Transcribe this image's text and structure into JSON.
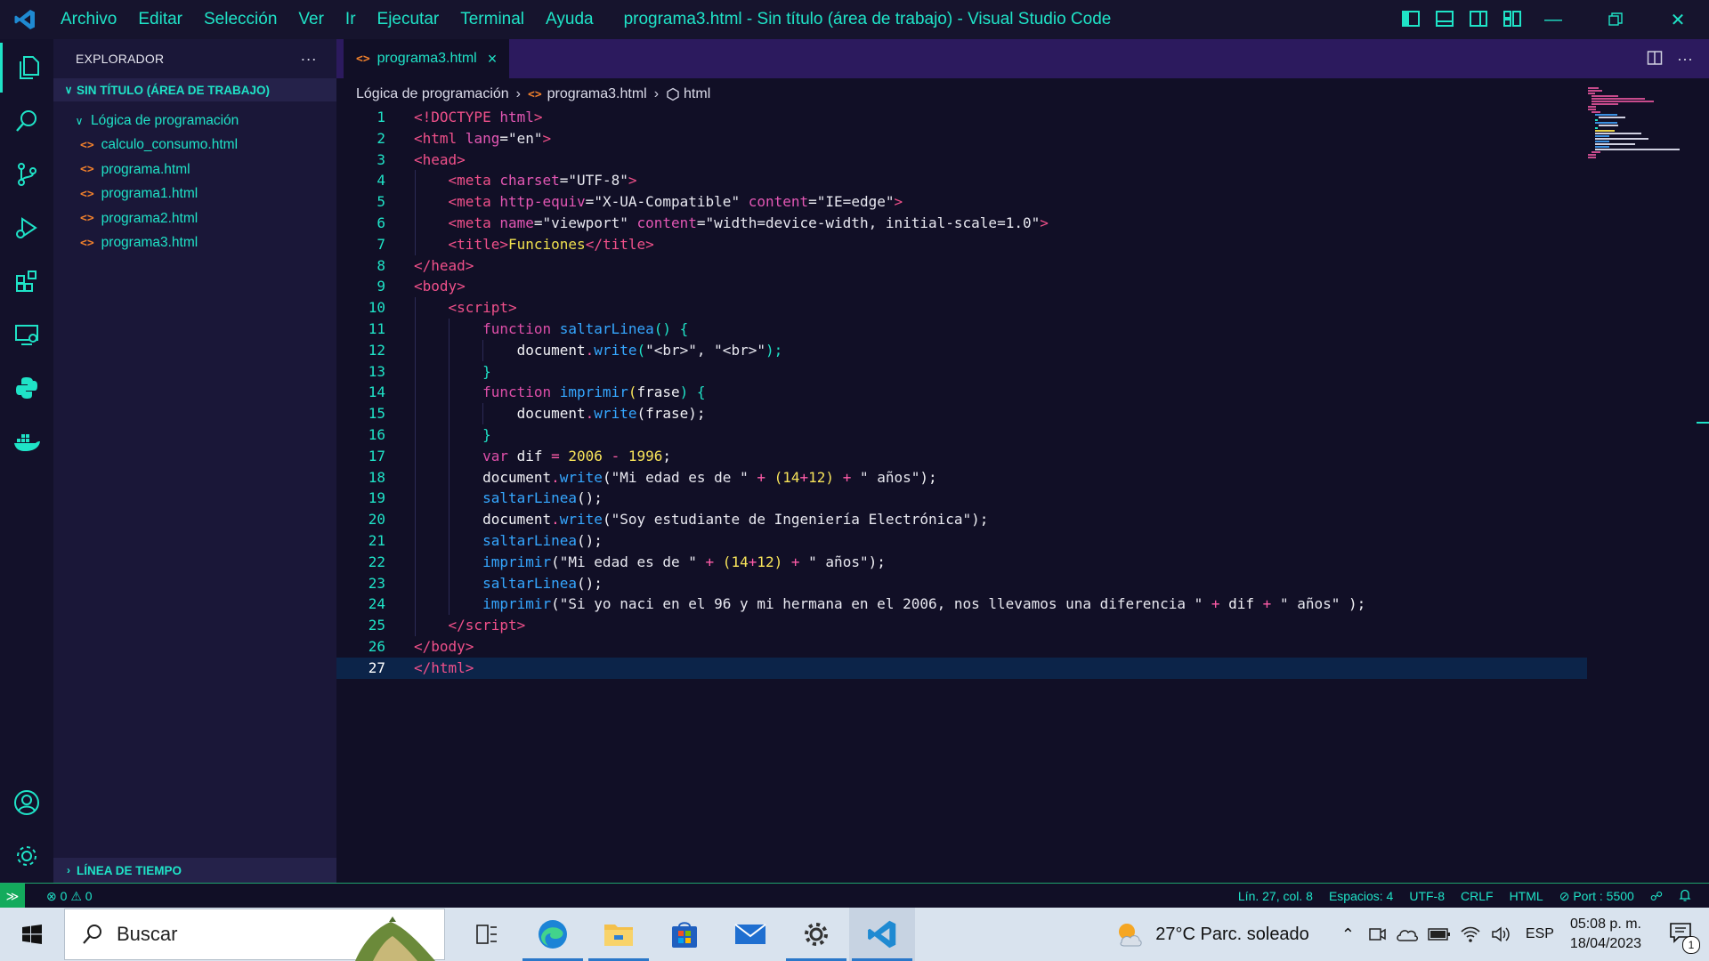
{
  "titlebar": {
    "menu": [
      "Archivo",
      "Editar",
      "Selección",
      "Ver",
      "Ir",
      "Ejecutar",
      "Terminal",
      "Ayuda"
    ],
    "title": "programa3.html - Sin título (área de trabajo) - Visual Studio Code"
  },
  "sidebar": {
    "header": "EXPLORADOR",
    "more": "···",
    "workspace": "SIN TÍTULO (ÁREA DE TRABAJO)",
    "folder": "Lógica de programación",
    "files": [
      "calculo_consumo.html",
      "programa.html",
      "programa1.html",
      "programa2.html",
      "programa3.html"
    ],
    "timeline": "LÍNEA DE TIEMPO"
  },
  "editor": {
    "tab": {
      "icon": "<>",
      "label": "programa3.html",
      "close": "×"
    },
    "breadcrumb": [
      "Lógica de programación",
      "programa3.html",
      "html"
    ],
    "line_numbers": [
      "1",
      "2",
      "3",
      "4",
      "5",
      "6",
      "7",
      "8",
      "9",
      "10",
      "11",
      "12",
      "13",
      "14",
      "15",
      "16",
      "17",
      "18",
      "19",
      "20",
      "21",
      "22",
      "23",
      "24",
      "25",
      "26",
      "27"
    ],
    "current_line": 27
  },
  "code": {
    "l1": [
      "<!",
      "DOCTYPE",
      " html",
      ">"
    ],
    "l2": [
      "<",
      "html",
      " lang",
      "=",
      "\"en\"",
      ">"
    ],
    "l3": [
      "<",
      "head",
      ">"
    ],
    "l4": [
      "<",
      "meta",
      " charset",
      "=",
      "\"UTF-8\"",
      ">"
    ],
    "l5": [
      "<",
      "meta",
      " http-equiv",
      "=",
      "\"X-UA-Compatible\"",
      " content",
      "=",
      "\"IE=edge\"",
      ">"
    ],
    "l6": [
      "<",
      "meta",
      " name",
      "=",
      "\"viewport\"",
      " content",
      "=",
      "\"width=device-width, initial-scale=1.0\"",
      ">"
    ],
    "l7": [
      "<",
      "title",
      ">",
      "Funciones",
      "</",
      "title",
      ">"
    ],
    "l8": [
      "</",
      "head",
      ">"
    ],
    "l9": [
      "<",
      "body",
      ">"
    ],
    "l10": [
      "<",
      "script",
      ">"
    ],
    "l11": [
      "function",
      " saltarLinea",
      "() {"
    ],
    "l12": [
      "document",
      ".",
      "write",
      "(",
      "\"<br>\", \"<br>\"",
      ");"
    ],
    "l13": [
      "}"
    ],
    "l14": [
      "function",
      " imprimir",
      "(",
      "frase",
      ") {"
    ],
    "l15": [
      "document",
      ".",
      "write",
      "(frase);"
    ],
    "l16": [
      "}"
    ],
    "l17": [
      "var",
      " dif",
      " = ",
      "2006",
      " - ",
      "1996",
      ";"
    ],
    "l18": [
      "document",
      ".",
      "write",
      "(",
      "\"Mi edad es de \"",
      " + ",
      "(",
      "14",
      "+",
      "12",
      ")",
      " + ",
      "\" años\"",
      ");"
    ],
    "l19": [
      "saltarLinea",
      "();"
    ],
    "l20": [
      "document",
      ".",
      "write",
      "(",
      "\"Soy estudiante de Ingeniería Electrónica\"",
      ");"
    ],
    "l21": [
      "saltarLinea",
      "();"
    ],
    "l22": [
      "imprimir",
      "(",
      "\"Mi edad es de \"",
      " + ",
      "(",
      "14",
      "+",
      "12",
      ")",
      " + ",
      "\" años\"",
      ");"
    ],
    "l23": [
      "saltarLinea",
      "();"
    ],
    "l24": [
      "imprimir",
      "(",
      "\"Si yo naci en el 96 y mi hermana en el 2006, nos llevamos una diferencia \"",
      " + ",
      "dif",
      " + ",
      "\" años\"",
      " );"
    ],
    "l25": [
      "</",
      "script",
      ">"
    ],
    "l26": [
      "</",
      "body",
      ">"
    ],
    "l27": [
      "</",
      "html",
      ">"
    ]
  },
  "statusbar": {
    "errors": "0",
    "warnings": "0",
    "position": "Lín. 27, col. 8",
    "spaces": "Espacios: 4",
    "encoding": "UTF-8",
    "eol": "CRLF",
    "language": "HTML",
    "port": "Port : 5500"
  },
  "taskbar": {
    "search_placeholder": "Buscar",
    "weather": "27°C  Parc. soleado",
    "lang": "ESP",
    "time": "05:08 p. m.",
    "date": "18/04/2023",
    "notif_count": "1"
  },
  "colors": {
    "accent": "#1fe3c7",
    "background": "#110f26",
    "tabbar": "#2c1a5e",
    "current_line": "#0c2449",
    "status_remote": "#13ab5c"
  },
  "icons": [
    "vscode-logo-icon",
    "explorer-icon",
    "search-icon",
    "source-control-icon",
    "run-debug-icon",
    "extensions-icon",
    "remote-explorer-icon",
    "python-icon",
    "docker-icon",
    "account-icon",
    "settings-gear-icon"
  ]
}
